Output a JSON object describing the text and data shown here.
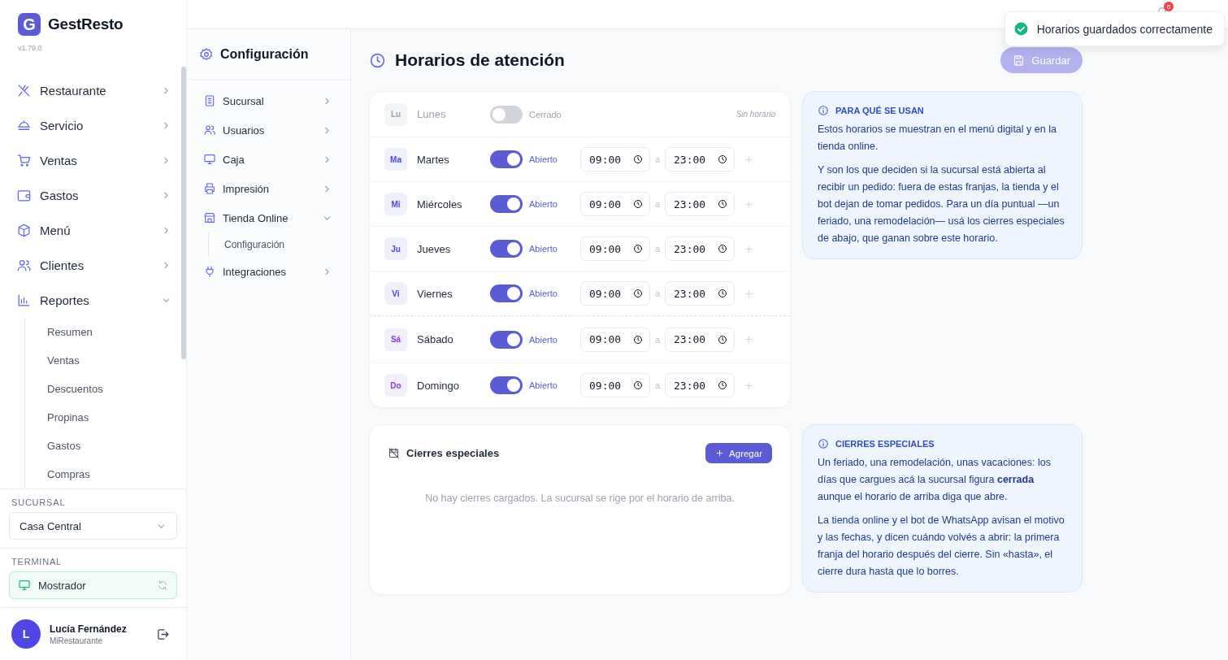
{
  "brand": {
    "name": "GestResto",
    "logo_letter": "G",
    "version": "v1.79.0"
  },
  "sidebar": {
    "items": [
      {
        "label": "Restaurante",
        "expanded": false
      },
      {
        "label": "Servicio",
        "expanded": false
      },
      {
        "label": "Ventas",
        "expanded": false
      },
      {
        "label": "Gastos",
        "expanded": false
      },
      {
        "label": "Menú",
        "expanded": false
      },
      {
        "label": "Clientes",
        "expanded": false
      },
      {
        "label": "Reportes",
        "expanded": true,
        "children": [
          {
            "label": "Resumen"
          },
          {
            "label": "Ventas"
          },
          {
            "label": "Descuentos"
          },
          {
            "label": "Propinas"
          },
          {
            "label": "Gastos"
          },
          {
            "label": "Compras"
          }
        ]
      }
    ],
    "branch": {
      "label": "SUCURSAL",
      "value": "Casa Central"
    },
    "terminal": {
      "label": "TERMINAL",
      "value": "Mostrador"
    },
    "user": {
      "initial": "L",
      "name": "Lucía Fernández",
      "org": "MiRestaurante"
    }
  },
  "top_bar": {
    "notification_badge": "6"
  },
  "toast": {
    "text": "Horarios guardados correctamente"
  },
  "config_nav": {
    "title": "Configuración",
    "items": [
      {
        "label": "Sucursal",
        "expanded": false
      },
      {
        "label": "Usuarios",
        "expanded": false
      },
      {
        "label": "Caja",
        "expanded": false
      },
      {
        "label": "Impresión",
        "expanded": false
      },
      {
        "label": "Tienda Online",
        "expanded": true,
        "children": [
          {
            "label": "Configuración"
          }
        ]
      },
      {
        "label": "Integraciones",
        "expanded": false
      }
    ]
  },
  "page": {
    "title": "Horarios de atención",
    "save_button": {
      "label": "Guardar",
      "disabled": true
    }
  },
  "schedule": {
    "no_schedule": "Sin horario",
    "days": [
      {
        "abbr": "Lu",
        "name": "Lunes",
        "open": false,
        "weekend": false,
        "status": "Cerrado"
      },
      {
        "abbr": "Ma",
        "name": "Martes",
        "open": true,
        "weekend": false,
        "status": "Abierto",
        "from": "09:00",
        "separator": "a",
        "to": "23:00"
      },
      {
        "abbr": "Mi",
        "name": "Miércoles",
        "open": true,
        "weekend": false,
        "status": "Abierto",
        "from": "09:00",
        "separator": "a",
        "to": "23:00"
      },
      {
        "abbr": "Ju",
        "name": "Jueves",
        "open": true,
        "weekend": false,
        "status": "Abierto",
        "from": "09:00",
        "separator": "a",
        "to": "23:00"
      },
      {
        "abbr": "Vi",
        "name": "Viernes",
        "open": true,
        "weekend": false,
        "status": "Abierto",
        "from": "09:00",
        "separator": "a",
        "to": "23:00"
      },
      {
        "abbr": "Sá",
        "name": "Sábado",
        "open": true,
        "weekend": true,
        "status": "Abierto",
        "from": "09:00",
        "separator": "a",
        "to": "23:00"
      },
      {
        "abbr": "Do",
        "name": "Domingo",
        "open": true,
        "weekend": true,
        "status": "Abierto",
        "from": "09:00",
        "separator": "a",
        "to": "23:00"
      }
    ]
  },
  "schedule_info": {
    "title": "PARA QUÉ SE USAN",
    "paragraphs": [
      "Estos horarios se muestran en el menú digital y en la tienda online.",
      "Y son los que deciden si la sucursal está abierta al recibir un pedido: fuera de estas franjas, la tienda y el bot dejan de tomar pedidos. Para un día puntual —un feriado, una remodelación— usá los cierres especiales de abajo, que ganan sobre este horario."
    ]
  },
  "closures": {
    "title": "Cierres especiales",
    "add_button": "Agregar",
    "empty_text": "No hay cierres cargados. La sucursal se rige por el horario de arriba."
  },
  "closures_info": {
    "title": "CIERRES ESPECIALES",
    "paragraphs": [
      "Un feriado, una remodelación, unas vacaciones: los días que cargues acá la sucursal figura **cerrada** aunque el horario de arriba diga que abre.",
      "La tienda online y el bot de WhatsApp avisan el motivo y las fechas, y dicen cuándo volvés a abrir: la primera franja del horario después del cierre. Sin «hasta», el cierre dura hasta que lo borres."
    ]
  }
}
